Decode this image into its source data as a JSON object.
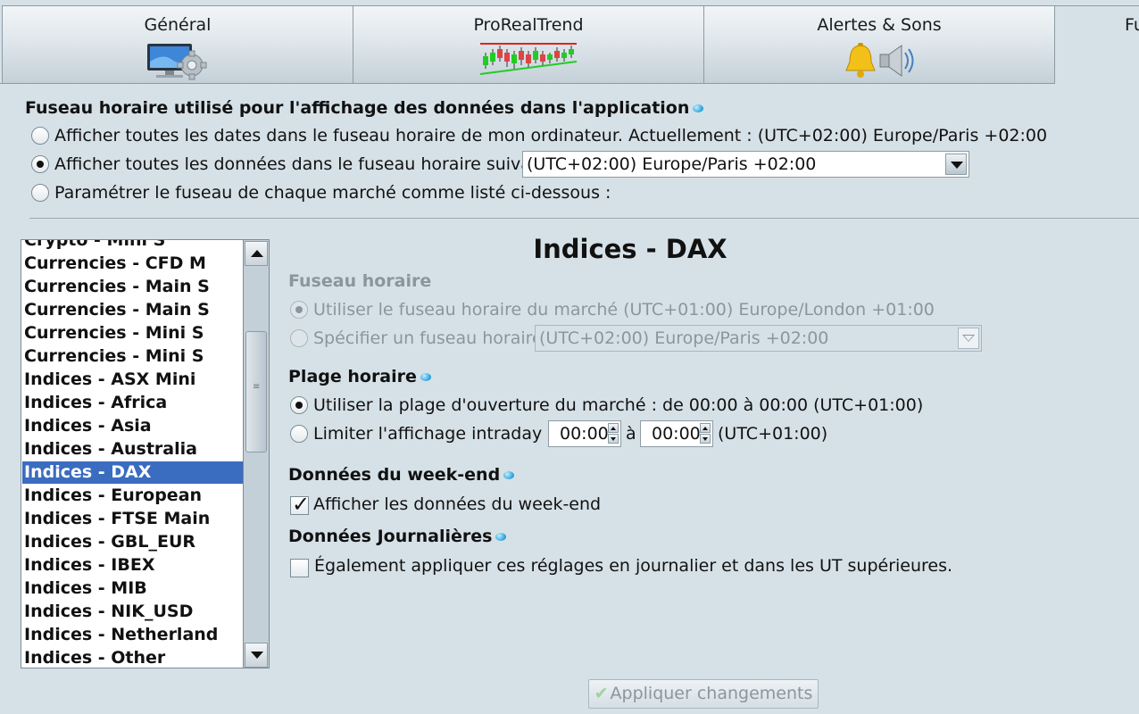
{
  "tabs": [
    {
      "label": "Général",
      "icon": "monitor-gear-icon"
    },
    {
      "label": "ProRealTrend",
      "icon": "trend-chart-icon"
    },
    {
      "label": "Alertes & Sons",
      "icon": "bell-speaker-icon"
    },
    {
      "label": "Fu",
      "icon": ""
    }
  ],
  "timezone_section": {
    "title": "Fuseau horaire utilisé pour l'affichage des données dans l'application",
    "option_computer": "Afficher toutes les dates dans le fuseau horaire de mon ordinateur. Actuellement : (UTC+02:00) Europe/Paris +02:00",
    "option_custom": "Afficher toutes les données dans le fuseau horaire suivant :",
    "option_custom_value": "(UTC+02:00) Europe/Paris +02:00",
    "option_per_market": "Paramétrer le fuseau de chaque marché comme listé ci-dessous :",
    "selected": "option_custom"
  },
  "market_list": {
    "items": [
      "Crypto - Mini S",
      "Currencies - CFD M",
      "Currencies - Main S",
      "Currencies - Main S",
      "Currencies - Mini S",
      "Currencies - Mini S",
      "Indices - ASX Mini",
      "Indices - Africa",
      "Indices - Asia",
      "Indices - Australia",
      "Indices - DAX",
      "Indices - European",
      "Indices - FTSE Main",
      "Indices - GBL_EUR",
      "Indices - IBEX",
      "Indices - MIB",
      "Indices - NIK_USD",
      "Indices - Netherland",
      "Indices - Other"
    ],
    "selected_index": 10
  },
  "detail": {
    "title": "Indices - DAX",
    "tz_heading": "Fuseau horaire",
    "tz_market": "Utiliser le fuseau horaire du marché (UTC+01:00) Europe/London +01:00",
    "tz_specify": "Spécifier un fuseau horaire :",
    "tz_specify_value": "(UTC+02:00) Europe/Paris +02:00",
    "range_heading": "Plage horaire",
    "range_market": "Utiliser la plage d'ouverture du marché : de 00:00 à 00:00 (UTC+01:00)",
    "range_limit_prefix": "Limiter l'affichage intraday de",
    "range_from": "00:00",
    "range_sep": "à",
    "range_to": "00:00",
    "range_tz": "(UTC+01:00)",
    "weekend_heading": "Données du week-end",
    "weekend_label": "Afficher les données du week-end",
    "weekend_checked": true,
    "daily_heading": "Données Journalières",
    "daily_label": "Également appliquer ces réglages en journalier et dans les UT supérieures.",
    "daily_checked": false
  },
  "apply_button": "Appliquer changements",
  "colors": {
    "background": "#d6e1e7",
    "selection": "#3a6cc0",
    "info_icon": "#2a9fd8"
  }
}
